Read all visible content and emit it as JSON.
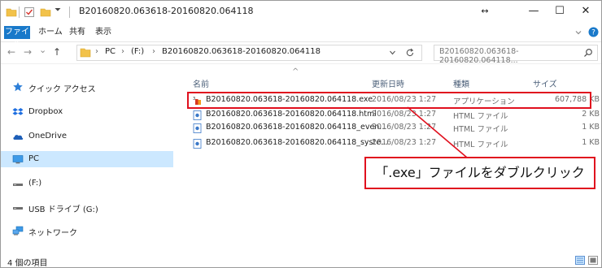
{
  "window": {
    "title": "B20160820.063618-20160820.064118",
    "controls": {
      "resize": "↔",
      "minimize": "—",
      "maximize": "☐",
      "close": "✕"
    }
  },
  "ribbon": {
    "tabs": [
      "ファイル",
      "ホーム",
      "共有",
      "表示"
    ],
    "expand_icon": "chevron-down-icon",
    "help_icon": "help-icon"
  },
  "address": {
    "back": "←",
    "forward": "→",
    "recent": "⌄",
    "up": "↑",
    "segments": [
      "PC",
      "(F:)",
      "B20160820.063618-20160820.064118"
    ],
    "separator": "›",
    "search_placeholder": "B20160820.063618-20160820.064118...",
    "search_icon": "⚲"
  },
  "nav": {
    "items": [
      {
        "label": "クイック アクセス",
        "icon": "quick-access-star-icon"
      },
      {
        "label": "Dropbox",
        "icon": "dropbox-icon"
      },
      {
        "label": "OneDrive",
        "icon": "onedrive-cloud-icon"
      },
      {
        "label": "PC",
        "icon": "pc-monitor-icon",
        "selected": true
      },
      {
        "label": "(F:)",
        "icon": "drive-icon"
      },
      {
        "label": "USB ドライブ (G:)",
        "icon": "usb-drive-icon"
      },
      {
        "label": "ネットワーク",
        "icon": "network-icon"
      }
    ]
  },
  "columns": {
    "name": "名前",
    "date": "更新日時",
    "type": "種類",
    "size": "サイズ",
    "sort_indicator": "^"
  },
  "files": [
    {
      "name": "B20160820.063618-20160820.064118.exe",
      "date": "2016/08/23 1:27",
      "type": "アプリケーション",
      "size": "607,788 KB",
      "icon": "exe-file-icon"
    },
    {
      "name": "B20160820.063618-20160820.064118.html",
      "date": "2016/08/23 1:27",
      "type": "HTML ファイル",
      "size": "2 KB",
      "icon": "html-file-icon"
    },
    {
      "name": "B20160820.063618-20160820.064118_even...",
      "date": "2016/08/23 1:27",
      "type": "HTML ファイル",
      "size": "1 KB",
      "icon": "html-file-icon"
    },
    {
      "name": "B20160820.063618-20160820.064118_syste...",
      "date": "2016/08/23 1:27",
      "type": "HTML ファイル",
      "size": "1 KB",
      "icon": "html-file-icon"
    }
  ],
  "annotation": {
    "text": "「.exe」ファイルをダブルクリック",
    "color": "#e0101e"
  },
  "status": {
    "item_count": "4 個の項目"
  },
  "colors": {
    "accent": "#1979ca",
    "selected_nav": "#cce8ff"
  }
}
